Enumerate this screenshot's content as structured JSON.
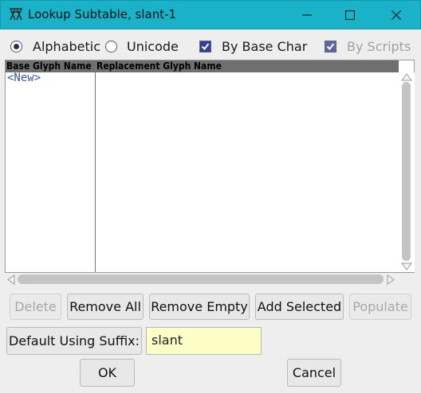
{
  "window": {
    "title": "Lookup Subtable, slant-1",
    "controls": {
      "minimize_icon": "minimize-icon",
      "maximize_icon": "maximize-icon",
      "close_icon": "close-icon"
    },
    "accent_color": "#19b2c8"
  },
  "options": {
    "sort_alphabetic": {
      "label": "Alphabetic",
      "checked": true
    },
    "sort_unicode": {
      "label": "Unicode",
      "checked": false
    },
    "by_base_char": {
      "label": "By Base Char",
      "checked": true
    },
    "by_scripts": {
      "label": "By Scripts",
      "checked": true,
      "enabled": false
    }
  },
  "table": {
    "columns": [
      "Base Glyph Name",
      "Replacement Glyph Name"
    ],
    "rows": [
      {
        "base": "<New>",
        "replacement": ""
      }
    ]
  },
  "buttons": {
    "delete": "Delete",
    "remove_all": "Remove All",
    "remove_empty": "Remove Empty",
    "add_selected": "Add Selected",
    "populate": "Populate",
    "default_using_suffix": "Default Using Suffix:",
    "ok": "OK",
    "cancel": "Cancel"
  },
  "suffix_field": {
    "value": "slant"
  }
}
